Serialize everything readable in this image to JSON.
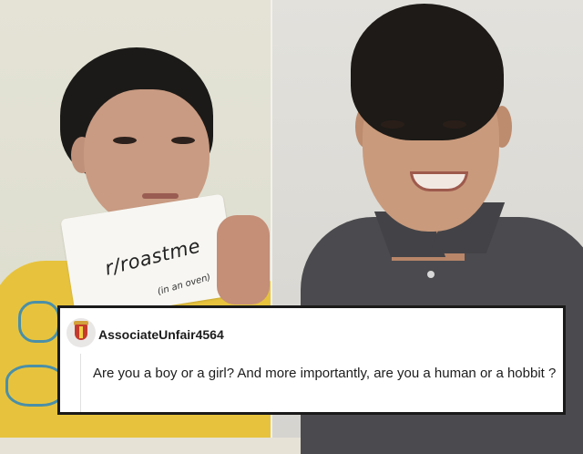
{
  "photo_left": {
    "sign_text": "r/roastme",
    "sign_subtext": "(in an oven)"
  },
  "comment_card": {
    "username": "AssociateUnfair4564",
    "avatar_icon": "coat-of-arms-avatar-icon",
    "text": "Are you a boy or a girl? And more importantly, are you a human or a hobbit ?"
  },
  "colors": {
    "left_shirt": "#e7c33d",
    "right_shirt": "#4b4b4f",
    "card_border": "#1a1a1a",
    "card_background": "#ffffff"
  }
}
